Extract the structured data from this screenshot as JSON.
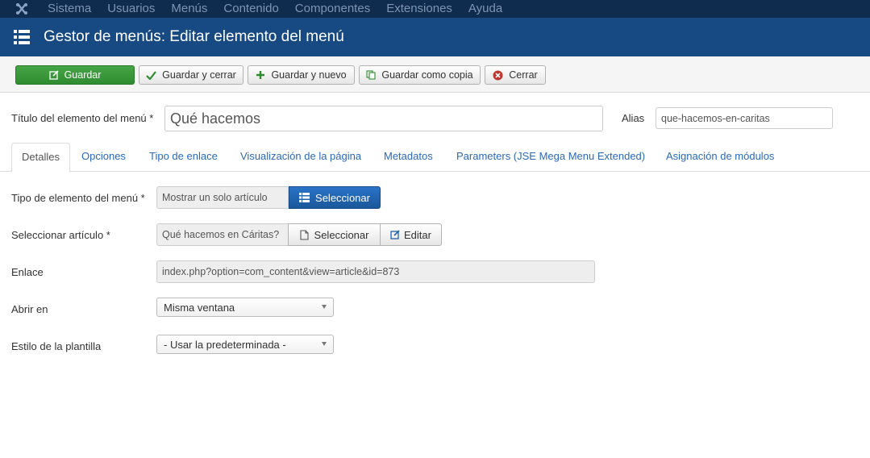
{
  "topnav": {
    "items": [
      "Sistema",
      "Usuarios",
      "Menús",
      "Contenido",
      "Componentes",
      "Extensiones",
      "Ayuda"
    ]
  },
  "header": {
    "title": "Gestor de menús: Editar elemento del menú"
  },
  "toolbar": {
    "save": "Guardar",
    "save_close": "Guardar y cerrar",
    "save_new": "Guardar y nuevo",
    "save_copy": "Guardar como copia",
    "close": "Cerrar"
  },
  "form": {
    "title_label": "Título del elemento del menú *",
    "title_value": "Qué hacemos",
    "alias_label": "Alias",
    "alias_value": "que-hacemos-en-caritas"
  },
  "tabs": [
    "Detalles",
    "Opciones",
    "Tipo de enlace",
    "Visualización de la página",
    "Metadatos",
    "Parameters (JSE Mega Menu Extended)",
    "Asignación de módulos"
  ],
  "details": {
    "type_label": "Tipo de elemento del menú *",
    "type_value": "Mostrar un solo artículo",
    "type_button": "Seleccionar",
    "article_label": "Seleccionar artículo *",
    "article_value": "Qué hacemos en Cáritas?",
    "article_select": "Seleccionar",
    "article_edit": "Editar",
    "link_label": "Enlace",
    "link_value": "index.php?option=com_content&view=article&id=873",
    "open_label": "Abrir en",
    "open_value": "Misma ventana",
    "style_label": "Estilo de la plantilla",
    "style_value": "- Usar la predeterminada -"
  },
  "colors": {
    "topnav_bg": "#0f2b4e",
    "header_bg": "#174a82",
    "save_green": "#3a9a3a",
    "select_blue": "#1f63ad",
    "tab_link": "#2a69b8"
  }
}
